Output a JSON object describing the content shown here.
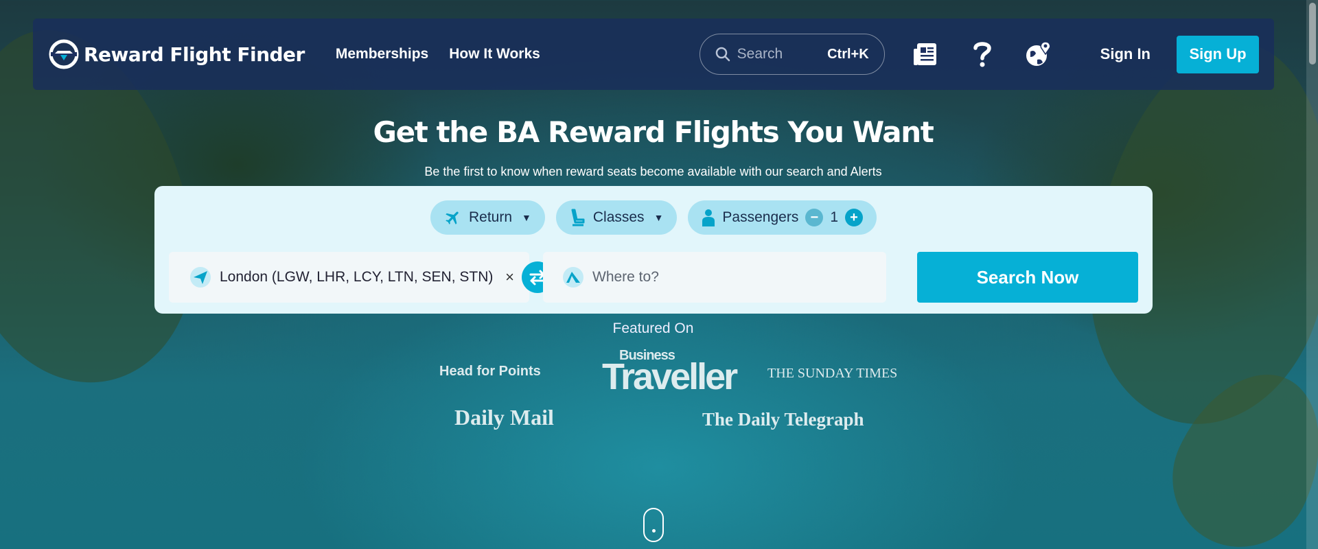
{
  "nav": {
    "brand": "Reward Flight Finder",
    "links": [
      "Memberships",
      "How It Works"
    ],
    "search": {
      "placeholder": "Search",
      "shortcut": "Ctrl+K"
    },
    "icons": [
      "news-icon",
      "help-icon",
      "globe-icon"
    ],
    "sign_in": "Sign In",
    "sign_up": "Sign Up"
  },
  "hero": {
    "title": "Get the BA Reward Flights You Want",
    "subtitle": "Be the first to know when reward seats become available with our search and Alerts"
  },
  "search_form": {
    "trip_type": "Return",
    "classes": "Classes",
    "passengers_label": "Passengers",
    "passengers_count": "1",
    "from_value": "London (LGW, LHR, LCY, LTN, SEN, STN)",
    "to_placeholder": "Where to?",
    "clear_symbol": "×",
    "submit": "Search Now"
  },
  "featured": {
    "label": "Featured On",
    "outlets": [
      "Head for Points",
      "Business Traveller",
      "THE SUNDAY TIMES",
      "Daily Mail",
      "The Daily Telegraph"
    ]
  },
  "colors": {
    "accent": "#06b0d6",
    "nav_bg": "#182d5c",
    "panel_bg": "#e2f6fb",
    "pill_bg": "#a9e2f2"
  }
}
